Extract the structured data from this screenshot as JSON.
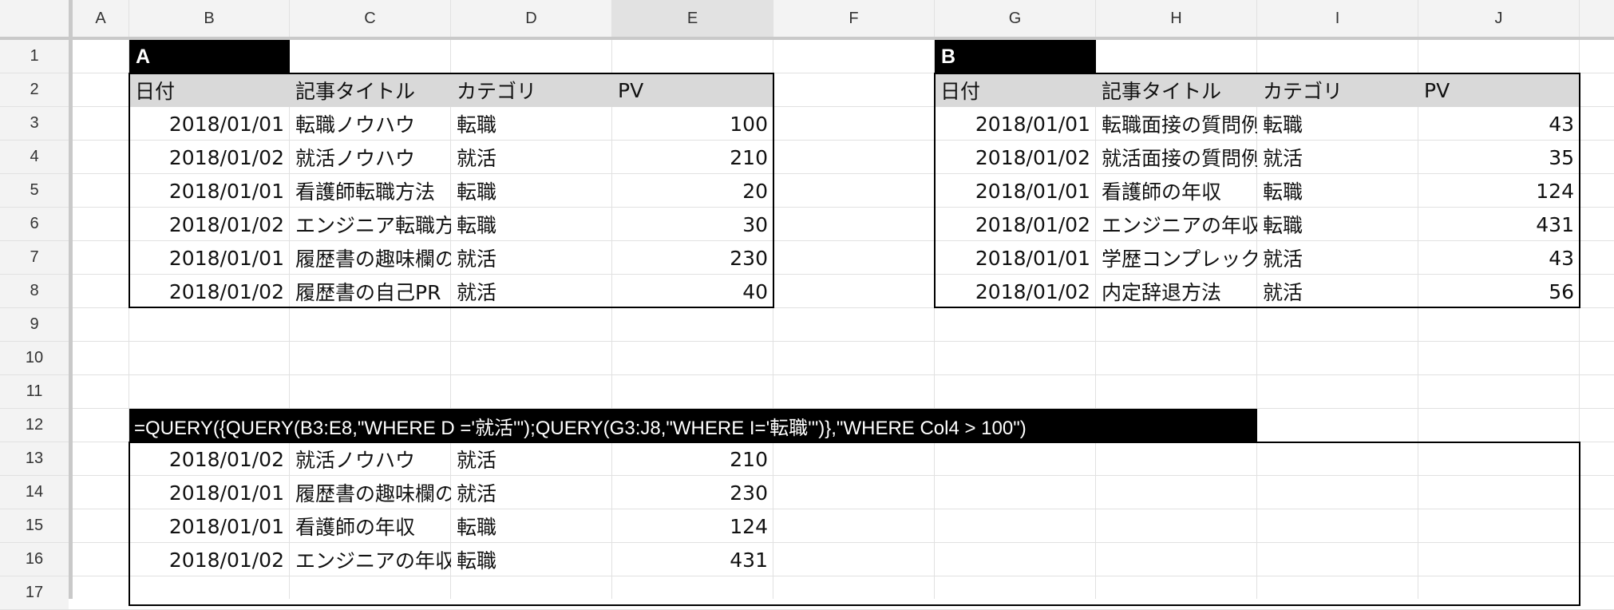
{
  "columns": [
    "A",
    "B",
    "C",
    "D",
    "E",
    "F",
    "G",
    "H",
    "I",
    "J"
  ],
  "selected_column": "E",
  "rows": [
    "1",
    "2",
    "3",
    "4",
    "5",
    "6",
    "7",
    "8",
    "9",
    "10",
    "11",
    "12",
    "13",
    "14",
    "15",
    "16",
    "17"
  ],
  "table_a": {
    "title": "A",
    "headers": [
      "日付",
      "記事タイトル",
      "カテゴリ",
      "PV"
    ],
    "rows": [
      [
        "2018/01/01",
        "転職ノウハウ",
        "転職",
        "100"
      ],
      [
        "2018/01/02",
        "就活ノウハウ",
        "就活",
        "210"
      ],
      [
        "2018/01/01",
        "看護師転職方法",
        "転職",
        "20"
      ],
      [
        "2018/01/02",
        "エンジニア転職方法",
        "転職",
        "30"
      ],
      [
        "2018/01/01",
        "履歴書の趣味欄の書き方",
        "就活",
        "230"
      ],
      [
        "2018/01/02",
        "履歴書の自己PR",
        "就活",
        "40"
      ]
    ]
  },
  "table_b": {
    "title": "B",
    "headers": [
      "日付",
      "記事タイトル",
      "カテゴリ",
      "PV"
    ],
    "rows": [
      [
        "2018/01/01",
        "転職面接の質問例",
        "転職",
        "43"
      ],
      [
        "2018/01/02",
        "就活面接の質問例",
        "就活",
        "35"
      ],
      [
        "2018/01/01",
        "看護師の年収",
        "転職",
        "124"
      ],
      [
        "2018/01/02",
        "エンジニアの年収",
        "転職",
        "431"
      ],
      [
        "2018/01/01",
        "学歴コンプレックス",
        "就活",
        "43"
      ],
      [
        "2018/01/02",
        "内定辞退方法",
        "就活",
        "56"
      ]
    ]
  },
  "formula": "=QUERY({QUERY(B3:E8,\"WHERE D ='就活'\");QUERY(G3:J8,\"WHERE I='転職'\")},\"WHERE Col4 > 100\")",
  "result": {
    "rows": [
      [
        "2018/01/02",
        "就活ノウハウ",
        "就活",
        "210"
      ],
      [
        "2018/01/01",
        "履歴書の趣味欄の書き方",
        "就活",
        "230"
      ],
      [
        "2018/01/01",
        "看護師の年収",
        "転職",
        "124"
      ],
      [
        "2018/01/02",
        "エンジニアの年収",
        "転職",
        "431"
      ]
    ]
  }
}
